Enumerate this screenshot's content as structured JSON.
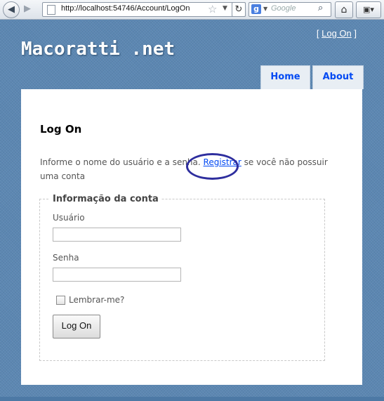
{
  "browser": {
    "url": "http://localhost:54746/Account/LogOn",
    "search_placeholder": "Google",
    "back_glyph": "◀",
    "forward_glyph": "▶",
    "icons": [
      "back-arrow-icon",
      "forward-arrow-icon",
      "page-icon",
      "star-icon",
      "dropdown-icon",
      "reload-icon",
      "google-icon",
      "search-icon",
      "home-icon",
      "bookmark-menu-icon"
    ]
  },
  "header": {
    "login_prefix": "[ ",
    "login_link": "Log On",
    "login_suffix": " ]",
    "site_title": "Macoratti .net"
  },
  "menu": {
    "items": [
      {
        "label": "Home"
      },
      {
        "label": "About"
      }
    ]
  },
  "main": {
    "title": "Log On",
    "intro_before": "Informe o nome do usuário e a senha. ",
    "intro_link": "Registrar",
    "intro_after": " se você não possuir uma conta",
    "fieldset": {
      "legend": "Informação da conta",
      "username_label": "Usuário",
      "username_value": "",
      "password_label": "Senha",
      "password_value": "",
      "remember_label": "Lembrar-me?",
      "submit_label": "Log On"
    }
  },
  "colors": {
    "site_background": "#5c87b2",
    "link": "#034af3",
    "annotation_circle": "#2e2e9e"
  }
}
